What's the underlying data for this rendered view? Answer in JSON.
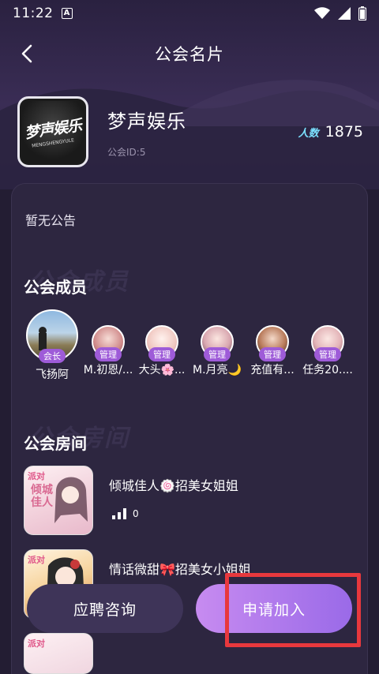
{
  "status_bar": {
    "time": "11:22",
    "indicator": "A"
  },
  "header": {
    "title": "公会名片"
  },
  "guild": {
    "name": "梦声娱乐",
    "id_text": "公会ID:5",
    "count_label": "人数",
    "count_value": "1875",
    "logo_text": "梦声娱乐",
    "logo_sub": "MENGSHENGYULE"
  },
  "notice": "暂无公告",
  "members_section": {
    "title": "公会成员",
    "watermark": "公会成员"
  },
  "members": [
    {
      "name": "飞扬阿",
      "role": "会长"
    },
    {
      "name": "M.初恩/...",
      "role": "管理"
    },
    {
      "name": "大头🌸...",
      "role": "管理"
    },
    {
      "name": "M.月亮🌙",
      "role": "管理"
    },
    {
      "name": "充值有...",
      "role": "管理"
    },
    {
      "name": "任务20....",
      "role": "管理"
    }
  ],
  "rooms_section": {
    "title": "公会房间",
    "watermark": "公会房间"
  },
  "rooms": [
    {
      "name": "倾城佳人🍥招美女姐姐",
      "listeners": "0",
      "tag": "派对",
      "cover_text": "倾城佳人"
    },
    {
      "name": "情话微甜🎀招美女小姐姐",
      "listeners": "",
      "tag": "派对",
      "cover_text": ""
    },
    {
      "name": "",
      "listeners": "",
      "tag": "派对",
      "cover_text": ""
    }
  ],
  "buttons": {
    "consult": "应聘咨询",
    "join": "申请加入"
  },
  "colors": {
    "accent": "#9e5bd8",
    "highlight": "#e8383d",
    "count_label": "#7be0ff"
  }
}
